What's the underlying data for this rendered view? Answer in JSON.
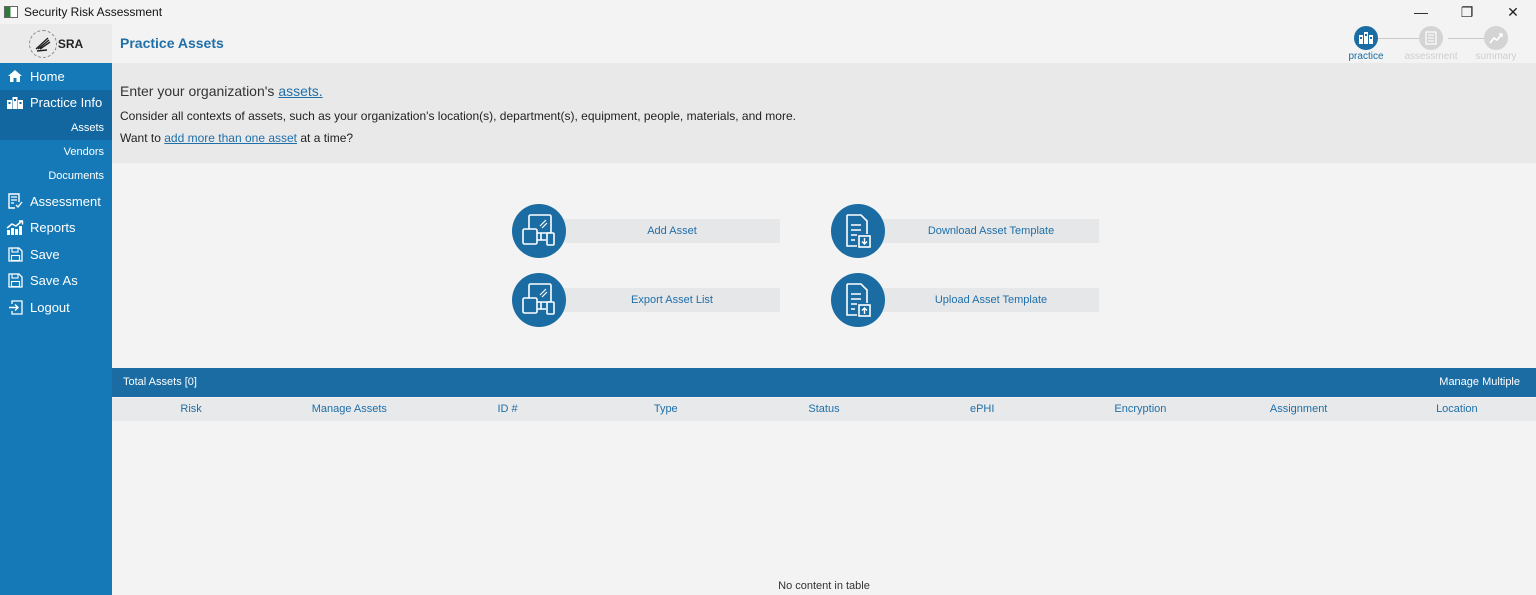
{
  "window": {
    "title": "Security Risk Assessment",
    "controls": {
      "minimize": "—",
      "maximize": "❐",
      "close": "✕"
    }
  },
  "logo": {
    "seal_icon": "hhs-eagle-seal",
    "text": "SRA"
  },
  "header": {
    "title": "Practice Assets"
  },
  "steps": [
    {
      "label": "practice",
      "icon": "building-icon",
      "state": "active"
    },
    {
      "label": "assessment",
      "icon": "checklist-icon",
      "state": "inactive"
    },
    {
      "label": "summary",
      "icon": "chart-up-icon",
      "state": "inactive"
    }
  ],
  "sidebar": {
    "items": [
      {
        "label": "Home",
        "icon": "home-icon"
      },
      {
        "label": "Practice Info",
        "icon": "building-icon",
        "children": [
          {
            "label": "Assets",
            "selected": true
          },
          {
            "label": "Vendors"
          },
          {
            "label": "Documents"
          }
        ]
      },
      {
        "label": "Assessment",
        "icon": "checklist-icon"
      },
      {
        "label": "Reports",
        "icon": "chart-up-icon"
      },
      {
        "label": "Save",
        "icon": "floppy-icon"
      },
      {
        "label": "Save As",
        "icon": "floppy-icon"
      },
      {
        "label": "Logout",
        "icon": "logout-icon"
      }
    ]
  },
  "intro": {
    "line1_prefix": "Enter your organization's ",
    "line1_link": "assets.",
    "line2": "Consider all contexts of assets, such as your organization's location(s), department(s), equipment, people, materials, and more.",
    "line3_prefix": "Want to ",
    "line3_link": "add more than one asset",
    "line3_suffix": " at a time?"
  },
  "actions": {
    "add_asset": "Add Asset",
    "download_template": "Download Asset Template",
    "export_list": "Export Asset List",
    "upload_template": "Upload Asset Template"
  },
  "table": {
    "total_label": "Total Assets [0]",
    "manage_multiple": "Manage Multiple",
    "columns": [
      "Risk",
      "Manage Assets",
      "ID #",
      "Type",
      "Status",
      "ePHI",
      "Encryption",
      "Assignment",
      "Location"
    ],
    "rows": [],
    "empty_text": "No content in table"
  },
  "colors": {
    "primary": "#1a6ca3",
    "sidebar": "#1479b6",
    "sidebar_selected": "#1267a0"
  }
}
